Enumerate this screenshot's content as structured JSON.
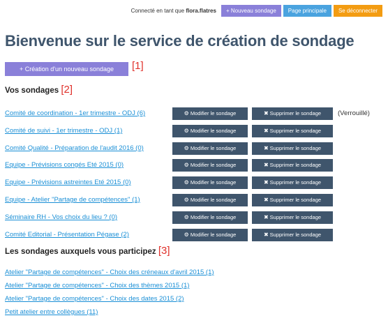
{
  "header": {
    "logged_prefix": "Connecté en tant que",
    "username": "flora.flatres",
    "new_survey": "+ Nouveau sondage",
    "home": "Page principale",
    "logout": "Se déconnecter"
  },
  "page_title": "Bienvenue sur le service de création de sondage",
  "create_button": "+ Création d'un nouveau sondage",
  "tags": {
    "t1": "[1]",
    "t2": "[2]",
    "t3": "[3]"
  },
  "my_surveys": {
    "title": "Vos sondages",
    "edit_label": "Modifier le sondage",
    "delete_label": "Supprimer le sondage",
    "items": [
      {
        "name": "Comité de coordination - 1er trimestre - ODJ (6)",
        "status": "(Verrouillé)"
      },
      {
        "name": "Comité de suivi - 1er trimestre - ODJ (1)"
      },
      {
        "name": "Comité Qualité - Préparation de l'audit 2016 (0)"
      },
      {
        "name": "Equipe - Prévisions congés Eté 2015 (0)"
      },
      {
        "name": "Equipe - Prévisions astreintes Eté 2015 (0)"
      },
      {
        "name": "Equipe - Atelier \"Partage de compétences\" (1)"
      },
      {
        "name": "Séminaire RH - Vos choix du lieu ? (0)"
      },
      {
        "name": "Comité Editorial - Présentation Pégase (2)"
      }
    ]
  },
  "participating": {
    "title": "Les sondages auxquels vous participez",
    "items": [
      "Atelier \"Partage de compétences\" - Choix des créneaux d'avril 2015 (1)",
      "Atelier \"Partage de compétences\" - Choix des thèmes 2015 (1)",
      "Atelier \"Partage de compétences\" - Choix des dates 2015 (2)",
      "Petit atelier entre collègues (11)"
    ]
  }
}
